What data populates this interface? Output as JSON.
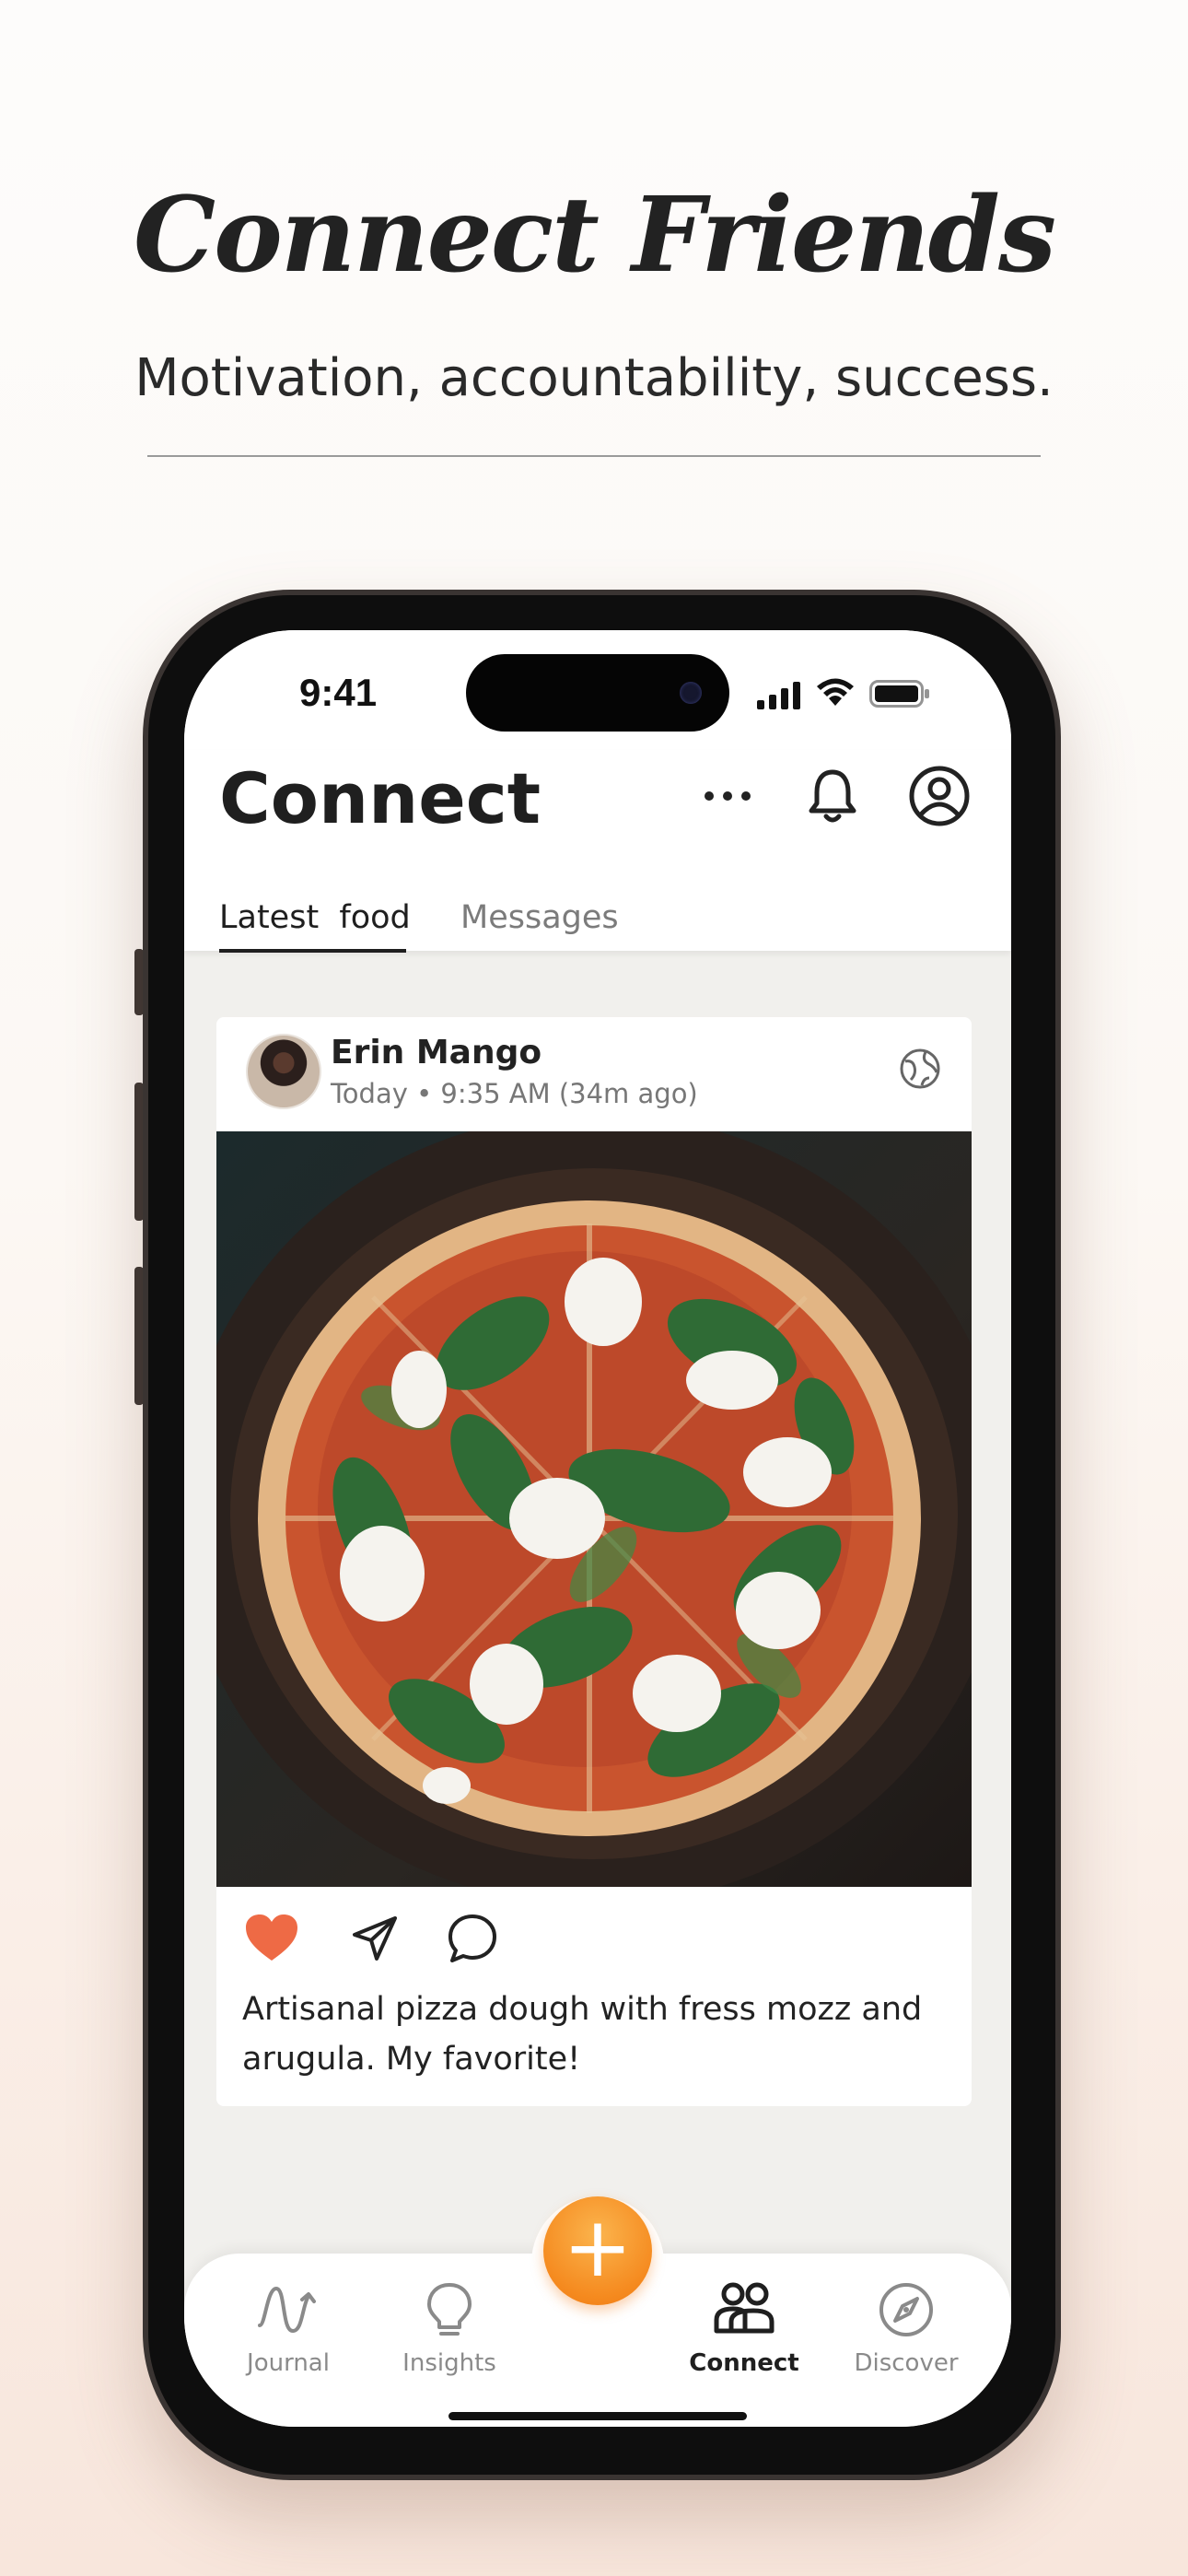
{
  "marketing": {
    "headline": "Connect Friends",
    "subheadline": "Motivation, accountability, success."
  },
  "status_bar": {
    "time": "9:41"
  },
  "header": {
    "title": "Connect",
    "icons": [
      "more-horizontal-icon",
      "bell-icon",
      "profile-icon"
    ]
  },
  "tabs": [
    {
      "label": "Latest  food",
      "active": true
    },
    {
      "label": "Messages",
      "active": false
    }
  ],
  "post": {
    "author": "Erin Mango",
    "timestamp": "Today • 9:35 AM (34m ago)",
    "visibility_icon": "globe-icon",
    "photo_subject": "pizza-photo",
    "liked": true,
    "caption": "Artisanal pizza dough with fress mozz and arugula. My favorite!"
  },
  "bottom_nav": {
    "items": [
      {
        "label": "Journal",
        "icon": "journal-wave-icon",
        "active": false
      },
      {
        "label": "Insights",
        "icon": "lightbulb-icon",
        "active": false
      },
      {
        "label": "Connect",
        "icon": "people-icon",
        "active": true
      },
      {
        "label": "Discover",
        "icon": "compass-icon",
        "active": false
      }
    ],
    "fab_label": "+"
  },
  "colors": {
    "accent_orange": "#F58A1F",
    "like_red": "#EE6A45",
    "text_dark": "#1F1F1F"
  }
}
